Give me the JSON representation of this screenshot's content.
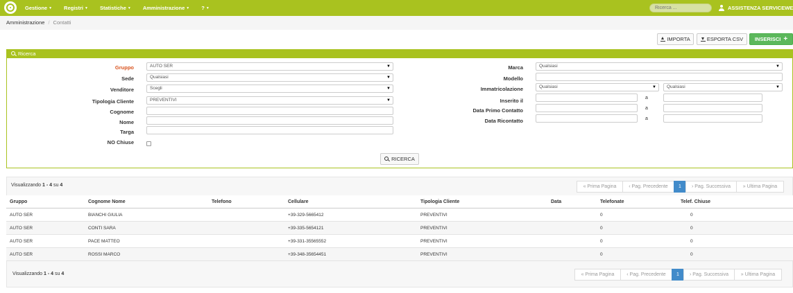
{
  "nav": {
    "items": [
      "Gestione",
      "Registri",
      "Statistiche",
      "Amministrazione",
      "?"
    ],
    "search_placeholder": "Ricerca ...",
    "user": "ASSISTENZA SERVICEWEB"
  },
  "breadcrumb": {
    "root": "Amministrazione",
    "current": "Contatti"
  },
  "actions": {
    "importa": "IMPORTA",
    "esporta": "ESPORTA CSV",
    "inserisci": "INSERISCI"
  },
  "search": {
    "title": "Ricerca",
    "left": [
      {
        "label": "Gruppo",
        "value": "AUTO SER",
        "type": "select"
      },
      {
        "label": "Sede",
        "value": "Qualsiasi",
        "type": "select"
      },
      {
        "label": "Venditore",
        "value": "Scegli",
        "type": "select"
      },
      {
        "label": "Tipologia Cliente",
        "value": "PREVENTIVI",
        "type": "select"
      },
      {
        "label": "Cognome",
        "value": "",
        "type": "text"
      },
      {
        "label": "Nome",
        "value": "",
        "type": "text"
      },
      {
        "label": "Targa",
        "value": "",
        "type": "text"
      },
      {
        "label": "NO Chiuse",
        "type": "checkbox",
        "checked": false
      }
    ],
    "right": {
      "marca": {
        "label": "Marca",
        "value": "Qualsiasi"
      },
      "modello": {
        "label": "Modello",
        "value": ""
      },
      "immatricolazione": {
        "label": "Immatricolazione",
        "from": "Qualsiasi",
        "to": "Qualsiasi"
      },
      "inserito": {
        "label": "Inserito il",
        "a": "a"
      },
      "data_primo": {
        "label": "Data Primo Contatto",
        "a": "a"
      },
      "data_ricontatto": {
        "label": "Data Ricontatto",
        "a": "a"
      }
    },
    "button": "RICERCA"
  },
  "results": {
    "info_prefix": "Visualizzando",
    "info_range": "1 - 4",
    "info_su": "su",
    "info_total": "4",
    "pager": [
      "« Prima Pagina",
      "‹ Pag. Precedente",
      "1",
      "› Pag. Successiva",
      "» Ultima Pagina"
    ],
    "columns": [
      "Gruppo",
      "Cognome Nome",
      "Telefono",
      "Cellulare",
      "Tipologia Cliente",
      "Data",
      "Telefonate",
      "Telef. Chiuse"
    ],
    "rows": [
      [
        "AUTO SER",
        "BIANCHI GIULIA",
        "",
        "+39-329-5665412",
        "PREVENTIVI",
        "",
        "0",
        "0"
      ],
      [
        "AUTO SER",
        "CONTI SARA",
        "",
        "+39-335-5654121",
        "PREVENTIVI",
        "",
        "0",
        "0"
      ],
      [
        "AUTO SER",
        "PACE MATTEO",
        "",
        "+39-331-35565552",
        "PREVENTIVI",
        "",
        "0",
        "0"
      ],
      [
        "AUTO SER",
        "ROSSI MARCO",
        "",
        "+39-348-35654451",
        "PREVENTIVI",
        "",
        "0",
        "0"
      ]
    ]
  },
  "colors": {
    "brand": "#a9c21f",
    "accent_red": "#d9531e",
    "primary": "#428bca",
    "success": "#5cb85c"
  }
}
